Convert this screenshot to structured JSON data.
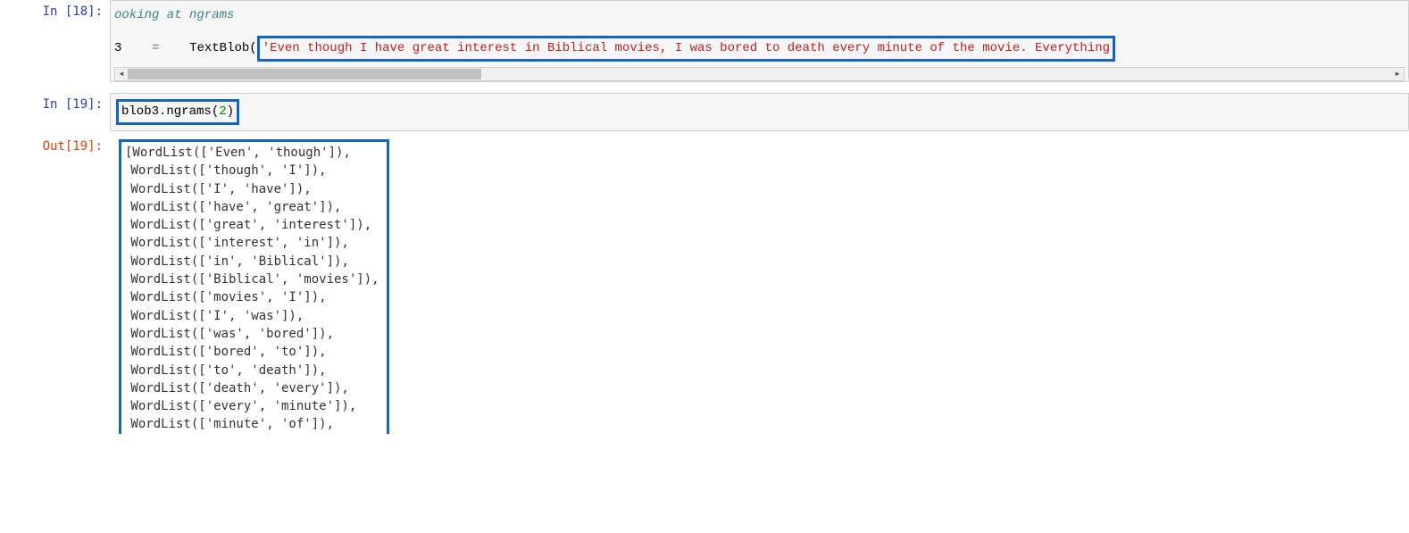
{
  "cell18": {
    "prompt": "In [18]:",
    "comment_fragment": "ooking at ngrams",
    "var_fragment": "3",
    "equals": "=",
    "func": "TextBlob(",
    "string_literal": "'Even though I have great interest in Biblical movies, I was bored to death every minute of the movie. Everything"
  },
  "cell19_in": {
    "prompt": "In [19]:",
    "code_obj": "blob3.ngrams(",
    "arg": "2",
    "close": ")"
  },
  "cell19_out": {
    "prompt": "Out[19]:",
    "lines": [
      "[WordList(['Even', 'though']),",
      " WordList(['though', 'I']),",
      " WordList(['I', 'have']),",
      " WordList(['have', 'great']),",
      " WordList(['great', 'interest']),",
      " WordList(['interest', 'in']),",
      " WordList(['in', 'Biblical']),",
      " WordList(['Biblical', 'movies']),",
      " WordList(['movies', 'I']),",
      " WordList(['I', 'was']),",
      " WordList(['was', 'bored']),",
      " WordList(['bored', 'to']),",
      " WordList(['to', 'death']),",
      " WordList(['death', 'every']),",
      " WordList(['every', 'minute']),",
      " WordList(['minute', 'of']),"
    ]
  }
}
